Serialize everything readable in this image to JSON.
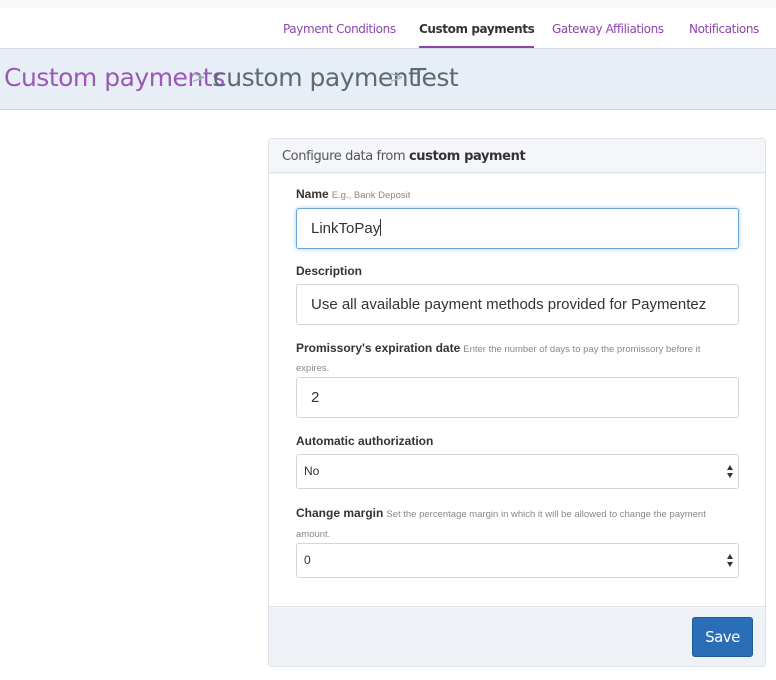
{
  "tabs": [
    {
      "label": "Payment Conditions",
      "active": false
    },
    {
      "label": "Custom payments",
      "active": true
    },
    {
      "label": "Gateway Affiliations",
      "active": false
    },
    {
      "label": "Notifications",
      "active": false
    }
  ],
  "breadcrumb": {
    "items": [
      "Custom payments",
      "custom payment",
      "Test"
    ],
    "separator": ">"
  },
  "panel": {
    "title_prefix": "Configure data from",
    "title_bold": "custom payment"
  },
  "form": {
    "name": {
      "label": "Name",
      "hint": "E.g., Bank Deposit",
      "value": "LinkToPay"
    },
    "description": {
      "label": "Description",
      "value": "Use all available payment methods provided for Paymentez"
    },
    "expiration": {
      "label": "Promissory's expiration date",
      "hint_line1": "Enter the number of days to pay the promissory before it",
      "hint_line2": "expires.",
      "value": "2"
    },
    "auto_auth": {
      "label": "Automatic authorization",
      "value": "No"
    },
    "change_margin": {
      "label": "Change margin",
      "hint_line1": "Set the percentage margin in which it will be allowed to change the payment",
      "hint_line2": "amount.",
      "value": "0"
    }
  },
  "footer": {
    "save_label": "Save"
  },
  "colors": {
    "accent": "#8e44ad",
    "primary_button": "#2b6eb8",
    "header_bg": "#e8eef5"
  }
}
